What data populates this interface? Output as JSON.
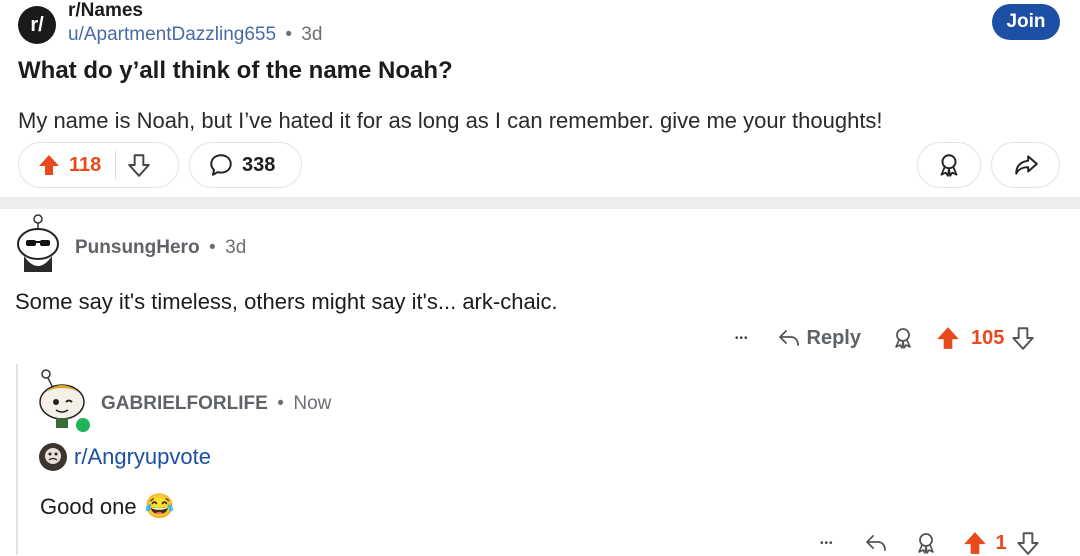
{
  "post": {
    "subreddit": "r/Names",
    "subreddit_icon": "r/",
    "author": "u/ApartmentDazzling655",
    "separator": "•",
    "age": "3d",
    "join_label": "Join",
    "title": "What do y’all think of the name Noah?",
    "body": "My name is Noah, but I’ve hated it for as long as I can remember. give me your thoughts!",
    "upvotes": "118",
    "comments": "338",
    "icons": [
      "upvote-icon",
      "downvote-icon",
      "comment-icon",
      "award-icon",
      "share-icon"
    ]
  },
  "comment1": {
    "username": "PunsungHero",
    "separator": "•",
    "age": "3d",
    "text": "Some say it's timeless, others might say it's... ark-chaic.",
    "more": "•••",
    "reply_label": "Reply",
    "upvotes": "105"
  },
  "comment2": {
    "username": "GABRIELFORLIFE",
    "separator": "•",
    "age": "Now",
    "link": "r/Angryupvote",
    "text": "Good one",
    "emoji": "😂",
    "more": "•••",
    "upvotes": "1",
    "online_color": "#1fb45a"
  },
  "colors": {
    "accent": "#e8491d",
    "link": "#1d4fa4",
    "join": "#1d4fa4"
  }
}
